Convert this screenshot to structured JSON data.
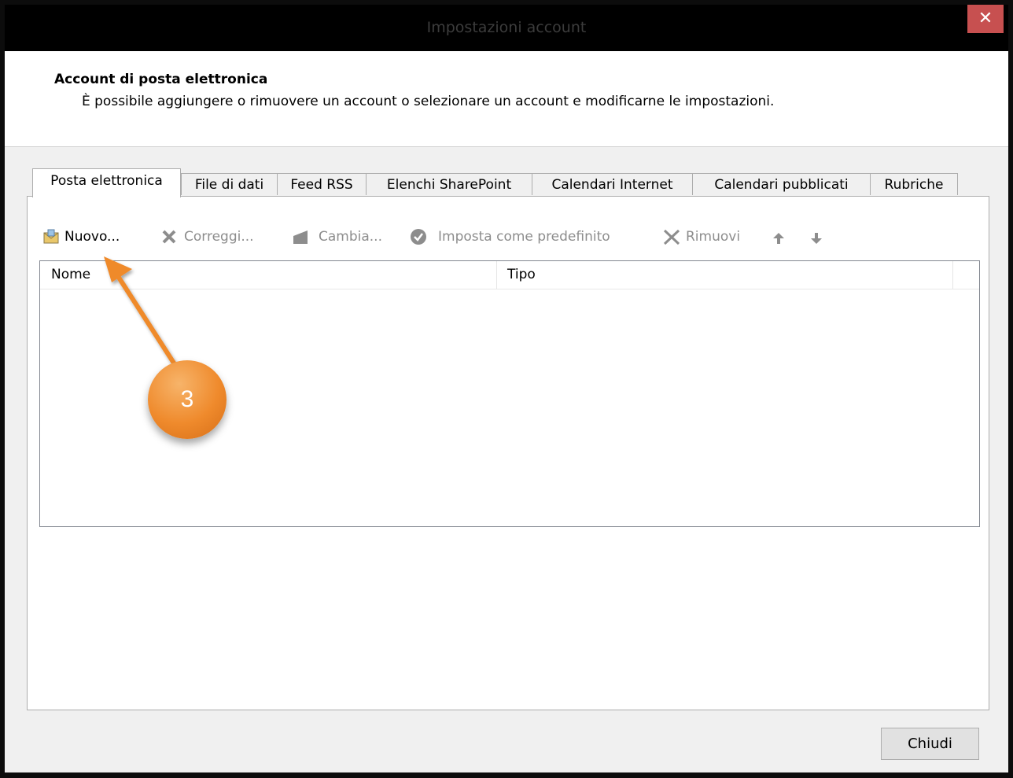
{
  "window": {
    "title": "Impostazioni account",
    "close_glyph": "✕"
  },
  "header": {
    "title": "Account di posta elettronica",
    "description": "È possibile aggiungere o rimuovere un account o selezionare un account e modificarne le impostazioni."
  },
  "tabs": [
    {
      "label": "Posta elettronica",
      "active": true
    },
    {
      "label": "File di dati",
      "active": false
    },
    {
      "label": "Feed RSS",
      "active": false
    },
    {
      "label": "Elenchi SharePoint",
      "active": false
    },
    {
      "label": "Calendari Internet",
      "active": false
    },
    {
      "label": "Calendari pubblicati",
      "active": false
    },
    {
      "label": "Rubriche",
      "active": false
    }
  ],
  "toolbar": {
    "new_label": "Nuovo...",
    "repair_label": "Correggi...",
    "change_label": "Cambia...",
    "set_default_label": "Imposta come predefinito",
    "remove_label": "Rimuovi",
    "icons": [
      "new-mail-icon",
      "wrench-tools-icon",
      "change-icon",
      "checkmark-icon",
      "remove-x-icon",
      "move-up-icon",
      "move-down-icon"
    ]
  },
  "account_list": {
    "columns": [
      "Nome",
      "Tipo"
    ],
    "rows": []
  },
  "footer": {
    "close_label": "Chiudi"
  },
  "annotation": {
    "step_number": "3",
    "color": "#ef8a2c"
  },
  "colors": {
    "titlebar": "#000000",
    "close_button": "#c75050",
    "dialog_bg": "#f0f0f0",
    "annotation_orange": "#ef8a2c"
  }
}
